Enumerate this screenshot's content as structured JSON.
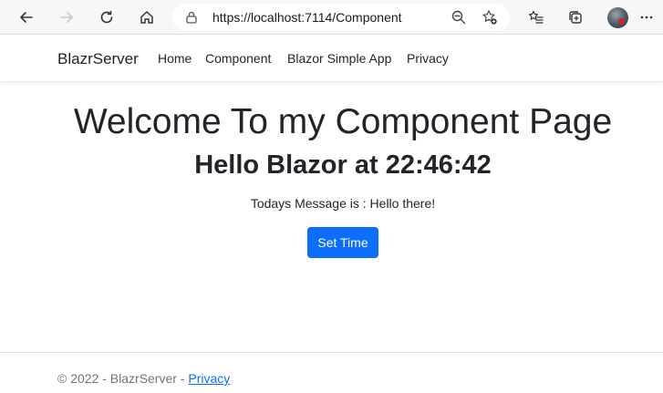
{
  "browser": {
    "url": "https://localhost:7114/Component"
  },
  "navbar": {
    "brand": "BlazrServer",
    "links": [
      "Home",
      "Component",
      "Blazor Simple App",
      "Privacy"
    ]
  },
  "main": {
    "heading": "Welcome To my Component Page",
    "subheading": "Hello Blazor at 22:46:42",
    "message": "Todays Message is : Hello there!",
    "button_label": "Set Time"
  },
  "footer": {
    "copyright": "© 2022 - BlazrServer - ",
    "privacy_link": "Privacy"
  },
  "colors": {
    "primary": "#0d6efd",
    "text": "#212529",
    "muted": "#6c757d"
  }
}
